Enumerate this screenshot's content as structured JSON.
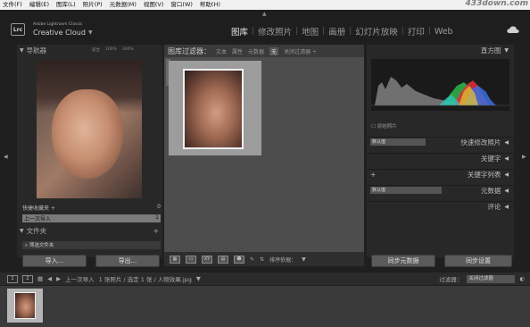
{
  "menubar": {
    "items": [
      "文件(F)",
      "编辑(E)",
      "图库(L)",
      "照片(P)",
      "元数据(M)",
      "视图(V)",
      "窗口(W)",
      "帮助(H)"
    ],
    "watermark": "433down.com"
  },
  "brand": {
    "logo": "Lrc",
    "subtitle": "Adobe Lightroom Classic",
    "title": "Creative Cloud"
  },
  "modules": [
    "图库",
    "修改照片",
    "地图",
    "画册",
    "幻灯片放映",
    "打印",
    "Web"
  ],
  "left": {
    "navigator_title": "导航器",
    "zoom_fit": "适合",
    "zoom_100": "100%",
    "zoom_300": "300%",
    "collections": [
      {
        "label": "快捷收藏夹 +",
        "count": "0"
      },
      {
        "label": "上一次导入",
        "count": "1"
      }
    ],
    "folder_title": "文件夹",
    "folder_row": "筛选文件夹",
    "import_label": "导入...",
    "export_label": "导出..."
  },
  "center": {
    "filter_title": "图库过滤器：",
    "filter_opts": [
      "文本",
      "属性",
      "元数据",
      "无"
    ],
    "filter_preset": "关闭过滤器 ÷",
    "sort_label": "排序依据："
  },
  "right": {
    "histogram_title": "直方图",
    "original_label": "原始照片",
    "rows": [
      {
        "label": "快速修改照片",
        "select": "默认值"
      },
      {
        "label": "关键字",
        "select": ""
      },
      {
        "label": "关键字列表",
        "select": "+"
      },
      {
        "label": "元数据",
        "select": "默认值"
      },
      {
        "label": "评论",
        "select": ""
      }
    ],
    "sync_meta_label": "同步元数据",
    "sync_set_label": "同步设置"
  },
  "filmbar": {
    "page1": "1",
    "page2": "2",
    "source": "上一次导入",
    "count": "1 张照片 / 选定 1 张 / 人物效果.jpg",
    "filter_label": "过滤器：",
    "filter_value": "关闭过滤器"
  },
  "colors": {
    "hist_red": "#e0303a",
    "hist_green": "#2fb84a",
    "hist_blue": "#3a6ee0",
    "hist_cyan": "#2ec8c8",
    "hist_yellow": "#e0c030"
  }
}
